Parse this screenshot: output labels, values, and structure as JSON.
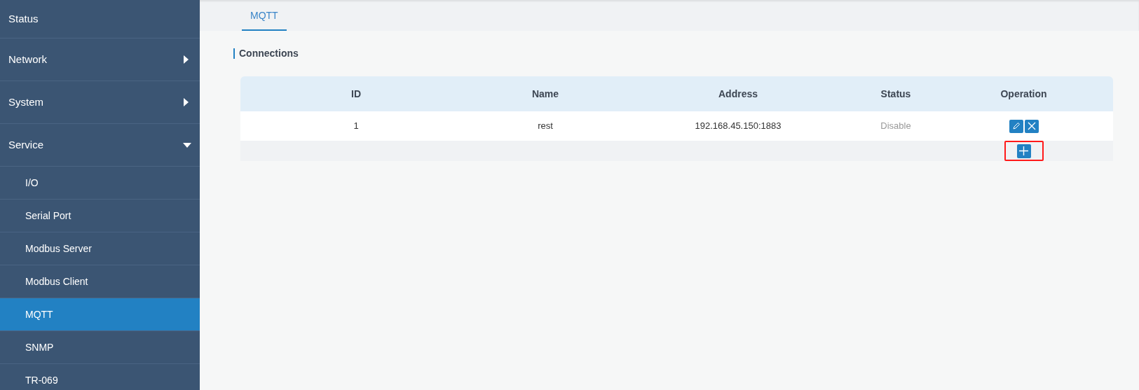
{
  "sidebar": {
    "items": [
      {
        "label": "Status",
        "kind": "top",
        "selected": false
      },
      {
        "label": "Network",
        "kind": "top",
        "expanded": false,
        "selected": false
      },
      {
        "label": "System",
        "kind": "top",
        "expanded": false,
        "selected": false
      },
      {
        "label": "Service",
        "kind": "top",
        "expanded": true,
        "selected": false
      },
      {
        "label": "I/O",
        "kind": "sub",
        "selected": false
      },
      {
        "label": "Serial Port",
        "kind": "sub",
        "selected": false
      },
      {
        "label": "Modbus Server",
        "kind": "sub",
        "selected": false
      },
      {
        "label": "Modbus Client",
        "kind": "sub",
        "selected": false
      },
      {
        "label": "MQTT",
        "kind": "sub",
        "selected": true
      },
      {
        "label": "SNMP",
        "kind": "sub",
        "selected": false
      },
      {
        "label": "TR-069",
        "kind": "sub",
        "selected": false
      }
    ]
  },
  "tabs": [
    {
      "label": "MQTT",
      "selected": true
    }
  ],
  "section_title": "Connections",
  "table": {
    "columns": [
      "ID",
      "Name",
      "Address",
      "Status",
      "Operation"
    ],
    "rows": [
      {
        "cells": [
          "1",
          "rest",
          "192.168.45.150:1883",
          "Disable"
        ]
      }
    ],
    "add_button": {
      "highlighted": true
    }
  }
}
